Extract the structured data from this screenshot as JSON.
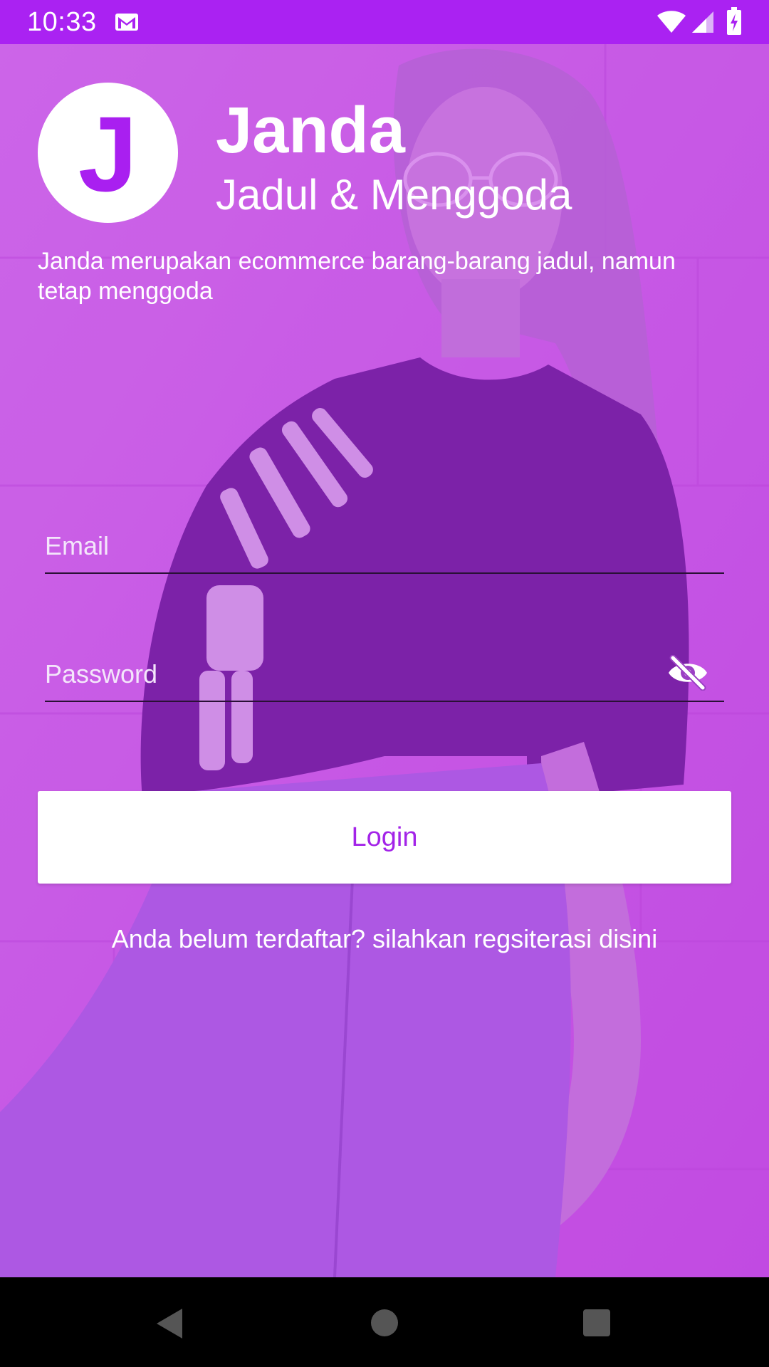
{
  "status_bar": {
    "time": "10:33",
    "background": "#aa22f2",
    "icons": [
      "gmail-icon",
      "wifi-icon",
      "signal-icon",
      "battery-charging-icon"
    ]
  },
  "header": {
    "logo_letter": "J",
    "title": "Janda",
    "subtitle": "Jadul & Menggoda",
    "description": "Janda merupakan ecommerce barang-barang jadul, namun tetap menggoda"
  },
  "form": {
    "email": {
      "placeholder": "Email",
      "value": ""
    },
    "password": {
      "placeholder": "Password",
      "value": "",
      "toggle_icon": "eye-off-icon"
    },
    "login_label": "Login",
    "register_text": "Anda belum terdaftar? silahkan regsiterasi disini"
  },
  "nav_bar": {
    "buttons": [
      "back-icon",
      "home-icon",
      "recents-icon"
    ]
  },
  "colors": {
    "accent": "#a91ff0",
    "overlay": "#c654e2",
    "button_background": "#ffffff"
  }
}
